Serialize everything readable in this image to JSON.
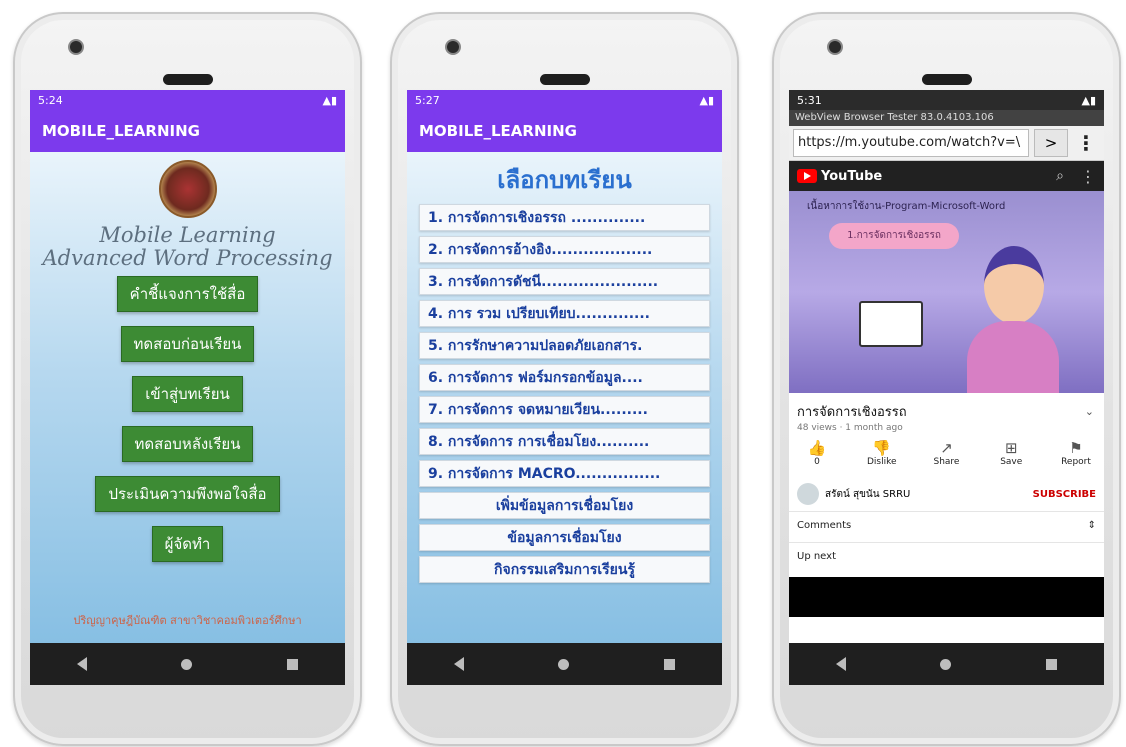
{
  "phones": [
    {
      "status_time": "5:24",
      "app_title": "MOBILE_LEARNING",
      "heading_line1": "Mobile Learning",
      "heading_line2": "Advanced Word Processing",
      "menu": [
        "คำชี้แจงการใช้สื่อ",
        "ทดสอบก่อนเรียน",
        "เข้าสู่บทเรียน",
        "ทดสอบหลังเรียน",
        "ประเมินความพึงพอใจสื่อ",
        "ผู้จัดทำ"
      ],
      "footer": "ปริญญาคุษฎีบัณฑิต สาขาวิชาคอมพิวเตอร์ศึกษา"
    },
    {
      "status_time": "5:27",
      "app_title": "MOBILE_LEARNING",
      "heading": "เลือกบทเรียน",
      "lessons": [
        "1. การจัดการเชิงอรรถ ..............",
        "2. การจัดการอ้างอิง...................",
        "3. การจัดการดัชนี......................",
        "4. การ รวม เปรียบเทียบ..............",
        "5. การรักษาความปลอดภัยเอกสาร.",
        "6. การจัดการ ฟอร์มกรอกข้อมูล....",
        "7. การจัดการ จดหมายเวียน.........",
        "8. การจัดการ การเชื่อมโยง..........",
        "9. การจัดการ MACRO................"
      ],
      "extra": [
        "เพิ่มข้อมูลการเชื่อมโยง",
        "ข้อมูลการเชื่อมโยง",
        "กิจกรรมเสริมการเรียนรู้"
      ]
    },
    {
      "status_time": "5:31",
      "webview_title": "WebView Browser Tester 83.0.4103.106",
      "url": "https://m.youtube.com/watch?v=\\",
      "go": ">",
      "more": "⋮",
      "yt_label": "YouTube",
      "thumb_text": "เนื้อหาการใช้งาน-Program-Microsoft-Word",
      "thumb_pill": "1.การจัดการเชิงอรรถ",
      "video_title": "การจัดการเชิงอรรถ",
      "video_meta": "48 views · 1 month ago",
      "actions": [
        {
          "icon": "👍",
          "label": "0"
        },
        {
          "icon": "👎",
          "label": "Dislike"
        },
        {
          "icon": "↗",
          "label": "Share"
        },
        {
          "icon": "⊞",
          "label": "Save"
        },
        {
          "icon": "⚑",
          "label": "Report"
        }
      ],
      "channel": "สรัตน์ สุขนัน SRRU",
      "subscribe": "SUBSCRIBE",
      "comments": "Comments",
      "up_next": "Up next"
    }
  ],
  "colors": {
    "purple": "#7c3aed",
    "green": "#3d8b34",
    "blue_text": "#1a3f9e"
  }
}
